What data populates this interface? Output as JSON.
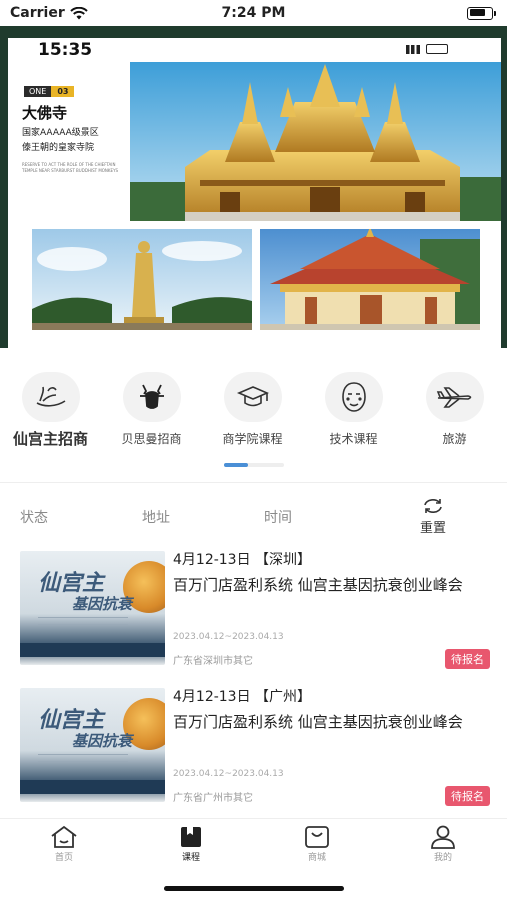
{
  "status_bar": {
    "carrier": "Carrier",
    "time": "7:24 PM"
  },
  "banner": {
    "poster_time": "15:35",
    "tag_one": "ONE",
    "tag_num": "03",
    "title": "大佛寺",
    "subtitle_line1": "国家AAAAA级景区",
    "subtitle_line2": "傣王朝的皇家寺院",
    "fine_print": "RESERVE TO ACT THE ROLE OF THE CHIEFTAIN TEMPLE NEAR STARBURST BUDDHIST MONKEYS",
    "page_count": 3,
    "active_page": 2
  },
  "categories": [
    {
      "label": "仙宫主招商",
      "icon": "hand-flower-icon"
    },
    {
      "label": "贝思曼招商",
      "icon": "deer-icon"
    },
    {
      "label": "商学院课程",
      "icon": "graduation-cap-icon"
    },
    {
      "label": "技术课程",
      "icon": "face-mask-icon"
    },
    {
      "label": "旅游",
      "icon": "airplane-icon"
    }
  ],
  "filters": {
    "status": "状态",
    "address": "地址",
    "time": "时间",
    "reset": "重置"
  },
  "events": [
    {
      "date": "4月12-13日 【深圳】",
      "title": "百万门店盈利系统 仙宫主基因抗衰创业峰会",
      "range": "2023.04.12~2023.04.13",
      "address": "广东省深圳市其它",
      "badge": "待报名",
      "thumb_title1": "仙宫主",
      "thumb_title2": "基因抗衰"
    },
    {
      "date": "4月12-13日 【广州】",
      "title": "百万门店盈利系统 仙宫主基因抗衰创业峰会",
      "range": "2023.04.12~2023.04.13",
      "address": "广东省广州市其它",
      "badge": "待报名",
      "thumb_title1": "仙宫主",
      "thumb_title2": "基因抗衰"
    }
  ],
  "tabbar": [
    {
      "label": "首页",
      "icon": "home-icon",
      "active": false
    },
    {
      "label": "课程",
      "icon": "book-icon",
      "active": true
    },
    {
      "label": "商城",
      "icon": "shopping-bag-icon",
      "active": false
    },
    {
      "label": "我的",
      "icon": "person-icon",
      "active": false
    }
  ],
  "colors": {
    "accent": "#4a8fd6",
    "badge": "#e8576e",
    "banner_bg": "#1f3b2d"
  }
}
